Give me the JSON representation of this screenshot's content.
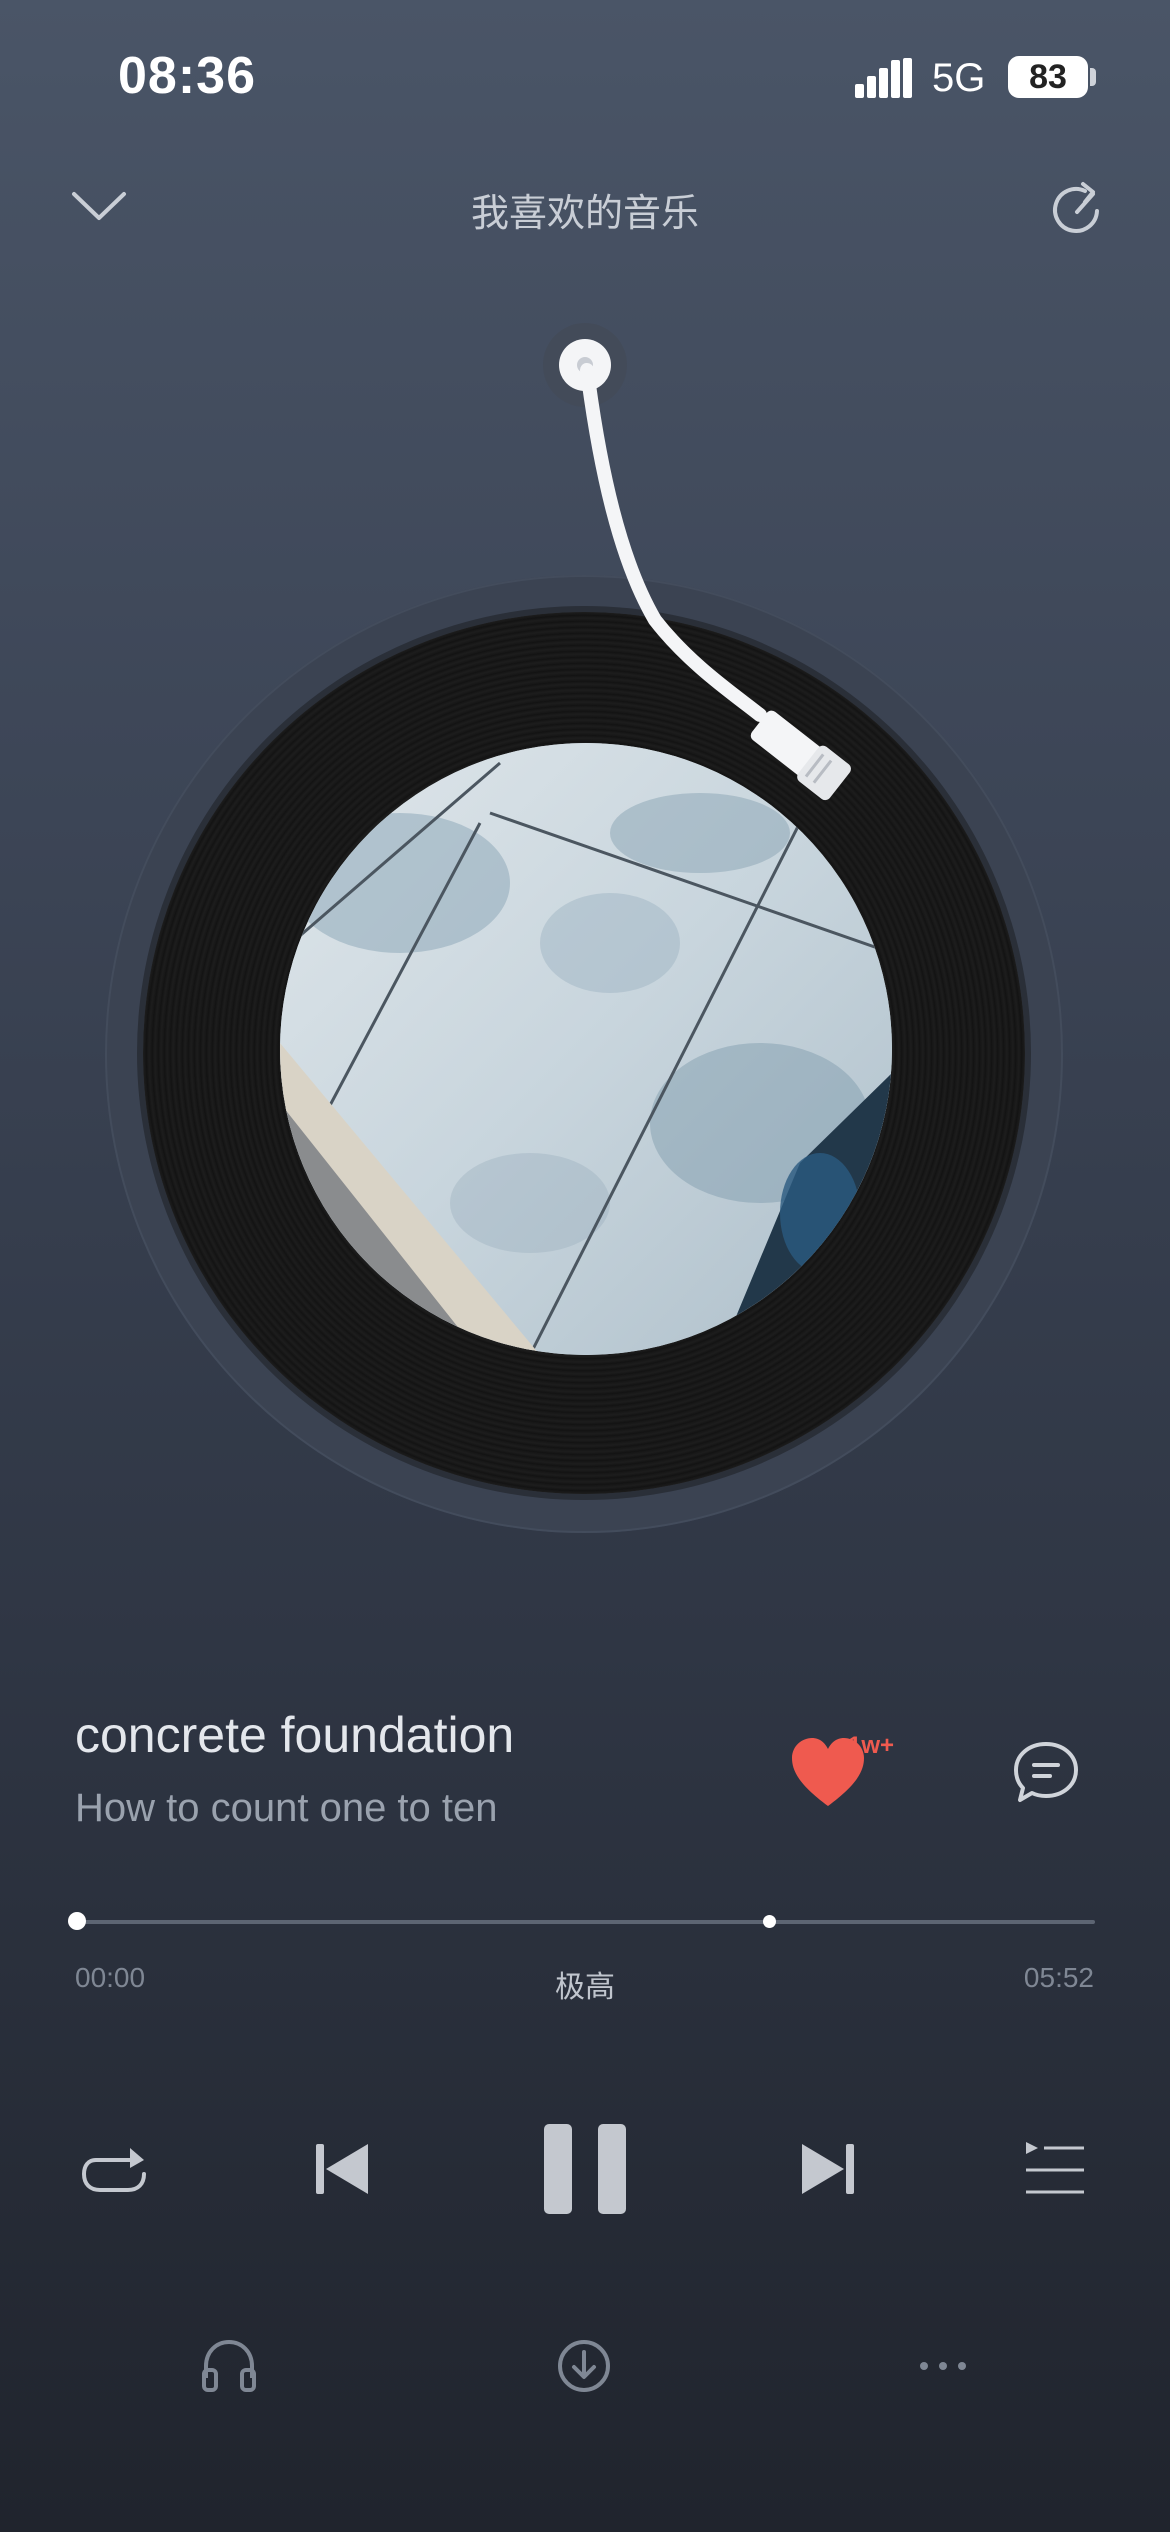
{
  "status_bar": {
    "time": "08:36",
    "network": "5G",
    "battery": "83"
  },
  "header": {
    "title": "我喜欢的音乐"
  },
  "song": {
    "title": "concrete foundation",
    "artist": "How to count one to ten",
    "like_count": "1w+"
  },
  "progress": {
    "current": "00:00",
    "duration": "05:52",
    "quality": "极高",
    "played_fraction": 0.0,
    "buffered_fraction": 0.68
  },
  "icons": {
    "collapse": "chevron-down-icon",
    "share": "share-icon",
    "like": "heart-icon",
    "comment": "comment-icon",
    "repeat": "repeat-icon",
    "prev": "skip-previous-icon",
    "pause": "pause-icon",
    "next": "skip-next-icon",
    "playlist": "playlist-icon",
    "headphone": "headphone-icon",
    "download": "download-icon",
    "more": "more-icon"
  },
  "colors": {
    "like": "#ef5a4f",
    "text_primary": "#e4e7ec",
    "text_secondary": "#9aa2ae"
  }
}
